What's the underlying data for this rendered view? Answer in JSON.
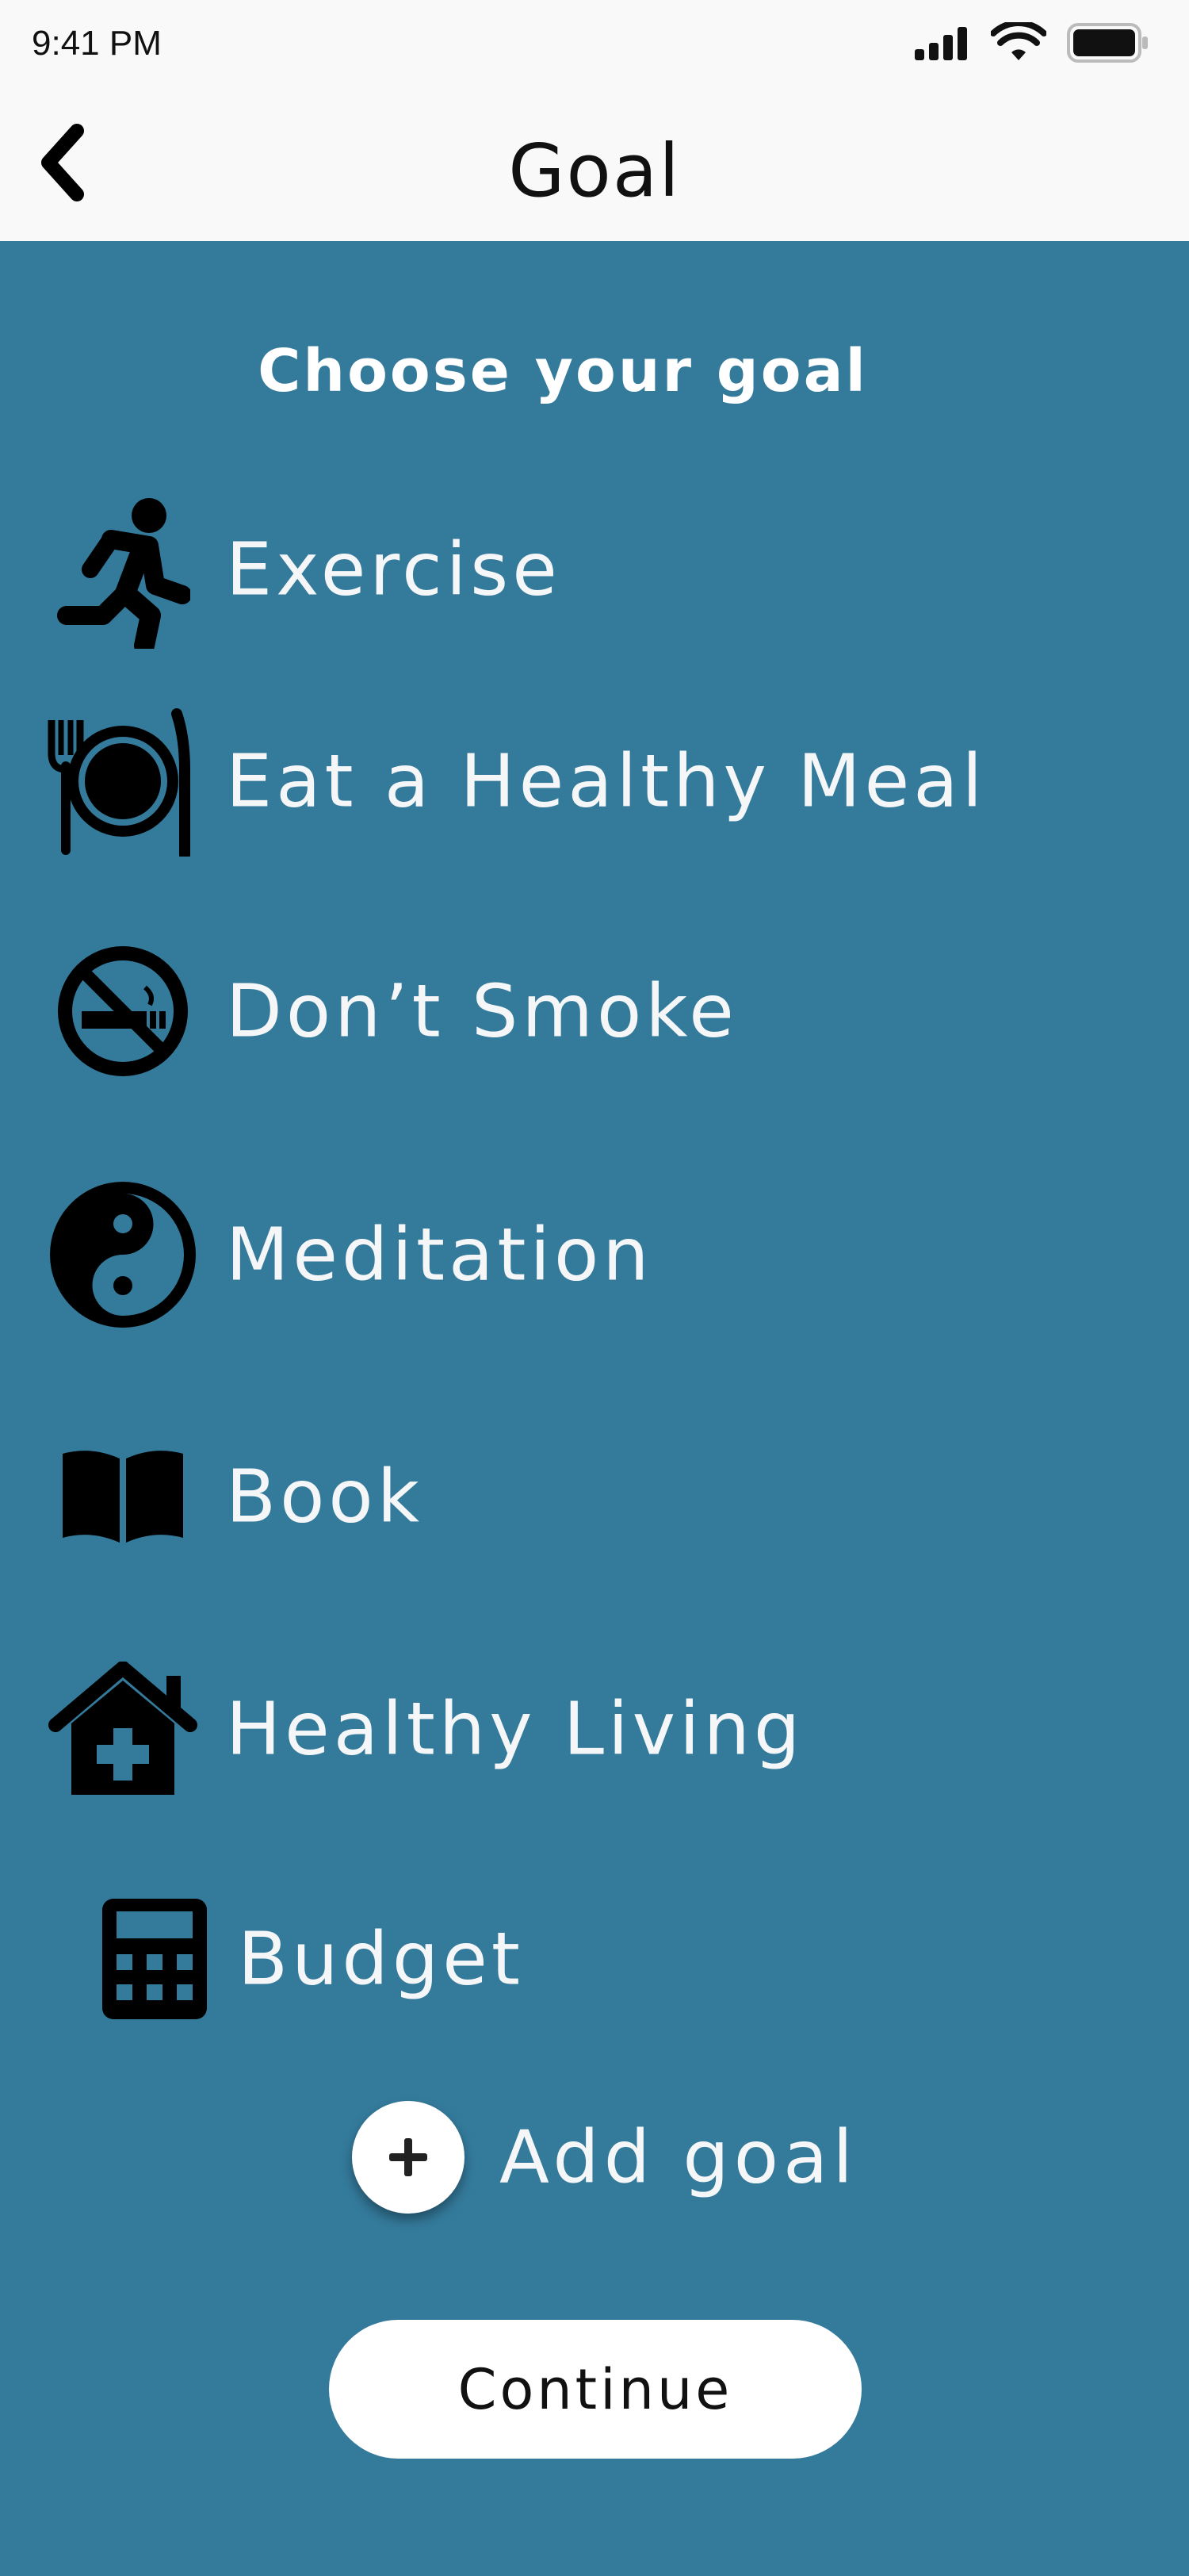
{
  "status": {
    "time": "9:41 PM",
    "icons": [
      "signal-icon",
      "wifi-icon",
      "battery-icon"
    ]
  },
  "nav": {
    "title": "Goal",
    "back_icon": "chevron-left-icon"
  },
  "heading": "Choose your goal",
  "goals": [
    {
      "label": "Exercise",
      "icon": "running-icon"
    },
    {
      "label": "Eat a Healthy Meal",
      "icon": "utensils-plate-icon"
    },
    {
      "label": "Don’t Smoke",
      "icon": "no-smoking-icon"
    },
    {
      "label": "Meditation",
      "icon": "yin-yang-icon"
    },
    {
      "label": "Book",
      "icon": "open-book-icon"
    },
    {
      "label": "Healthy Living",
      "icon": "clinic-house-icon"
    },
    {
      "label": "Budget",
      "icon": "calculator-icon"
    }
  ],
  "add_goal": {
    "label": "Add goal",
    "icon": "plus-icon"
  },
  "continue_label": "Continue",
  "colors": {
    "background": "#347a9b",
    "bar": "#f9f9f9",
    "text_light": "#f4f6f8",
    "button": "#ffffff"
  }
}
